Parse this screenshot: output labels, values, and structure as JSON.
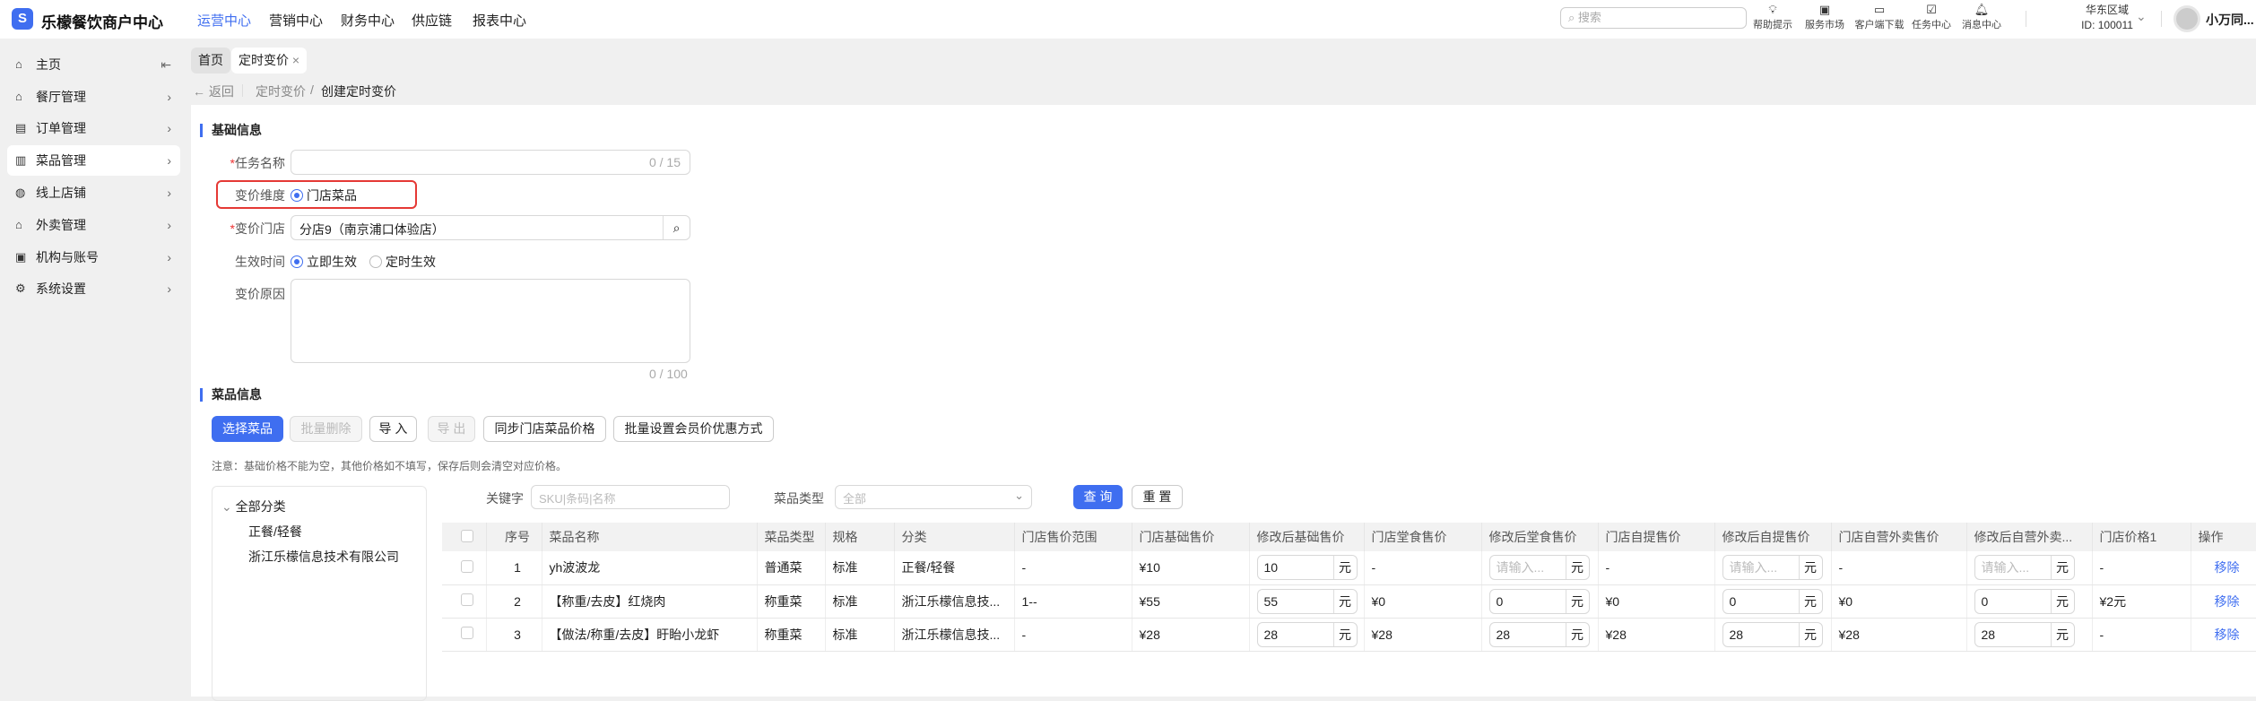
{
  "app": {
    "title": "乐檬餐饮商户中心",
    "logo_glyph": "S"
  },
  "nav": [
    "运营中心",
    "营销中心",
    "财务中心",
    "供应链",
    "报表中心"
  ],
  "search_placeholder": "搜索",
  "top_icons": [
    {
      "icon": "lightbulb-icon",
      "label": "帮助提示"
    },
    {
      "icon": "bag-icon",
      "label": "服务市场"
    },
    {
      "icon": "folder-download-icon",
      "label": "客户端下载"
    },
    {
      "icon": "clipboard-icon",
      "label": "任务中心"
    },
    {
      "icon": "bell-icon",
      "label": "消息中心"
    }
  ],
  "region": {
    "name": "华东区域",
    "id": "ID: 100011"
  },
  "user": {
    "name": "小万同..."
  },
  "sidebar": [
    {
      "label": "主页"
    },
    {
      "label": "餐厅管理"
    },
    {
      "label": "订单管理"
    },
    {
      "label": "菜品管理"
    },
    {
      "label": "线上店铺"
    },
    {
      "label": "外卖管理"
    },
    {
      "label": "机构与账号"
    },
    {
      "label": "系统设置"
    }
  ],
  "tabs": [
    {
      "label": "首页"
    },
    {
      "label": "定时变价",
      "close": "×"
    }
  ],
  "breadcrumb": {
    "back": "返回",
    "parent": "定时变价",
    "sep": "/",
    "current": "创建定时变价"
  },
  "basic": {
    "title": "基础信息",
    "task_name": {
      "label": "任务名称",
      "value": "",
      "counter": "0 / 15"
    },
    "dimension": {
      "label": "变价维度",
      "option": "门店菜品"
    },
    "store": {
      "label": "变价门店",
      "value": "分店9（南京浦口体验店）"
    },
    "effective": {
      "label": "生效时间",
      "options": [
        "立即生效",
        "定时生效"
      ]
    },
    "reason": {
      "label": "变价原因",
      "counter": "0 / 100"
    }
  },
  "dishes": {
    "title": "菜品信息",
    "buttons": [
      "选择菜品",
      "批量删除",
      "导 入",
      "导 出",
      "同步门店菜品价格",
      "批量设置会员价优惠方式"
    ],
    "note": "注意：基础价格不能为空，其他价格如不填写，保存后则会清空对应价格。",
    "tree": {
      "root": "全部分类",
      "children": [
        "正餐/轻餐",
        "浙江乐檬信息技术有限公司"
      ]
    },
    "filter": {
      "keyword_label": "关键字",
      "keyword_placeholder": "SKU|条码|名称",
      "type_label": "菜品类型",
      "type_value": "全部",
      "query": "查 询",
      "reset": "重 置"
    },
    "columns": [
      "序号",
      "菜品名称",
      "菜品类型",
      "规格",
      "分类",
      "门店售价范围",
      "门店基础售价",
      "修改后基础售价",
      "门店堂食售价",
      "修改后堂食售价",
      "门店自提售价",
      "修改后自提售价",
      "门店自营外卖售价",
      "修改后自营外卖...",
      "门店价格1",
      "操作"
    ],
    "unit": "元",
    "input_placeholder": "请输入...",
    "remove": "移除",
    "rows": [
      [
        "1",
        "yh波波龙",
        "普通菜",
        "标准",
        "正餐/轻餐",
        "-",
        "¥10",
        "10",
        "-",
        "",
        "-",
        "",
        "-",
        "",
        "-"
      ],
      [
        "2",
        "【称重/去皮】红烧肉",
        "称重菜",
        "标准",
        "浙江乐檬信息技...",
        "1--",
        "¥55",
        "55",
        "¥0",
        "0",
        "¥0",
        "0",
        "¥0",
        "0",
        "¥2元"
      ],
      [
        "3",
        "【做法/称重/去皮】盱眙小龙虾",
        "称重菜",
        "标准",
        "浙江乐檬信息技...",
        "-",
        "¥28",
        "28",
        "¥28",
        "28",
        "¥28",
        "28",
        "¥28",
        "28",
        "-"
      ]
    ]
  },
  "colors": {
    "accent": "#3f6ef0",
    "highlight": "#e53935"
  }
}
